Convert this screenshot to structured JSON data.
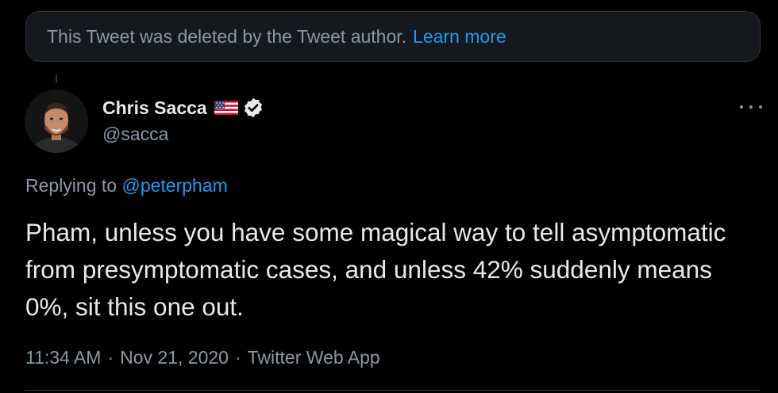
{
  "deleted_notice": {
    "text": "This Tweet was deleted by the Tweet author.",
    "link_label": "Learn more"
  },
  "tweet": {
    "display_name": "Chris Sacca",
    "flag_icon": "us-flag-icon",
    "verified_icon": "verified-badge-icon",
    "handle": "@sacca",
    "replying_prefix": "Replying to",
    "replying_to": "@peterpham",
    "text": "Pham, unless you have some magical way to tell asymptomatic from presymptomatic cases, and unless 42% suddenly means 0%, sit this one out.",
    "time": "11:34 AM",
    "date": "Nov 21, 2020",
    "source": "Twitter Web App",
    "separator": "·"
  },
  "colors": {
    "background": "#000000",
    "accent": "#1d9bf0",
    "muted": "#8b98a5",
    "text": "#e7e9ea"
  }
}
